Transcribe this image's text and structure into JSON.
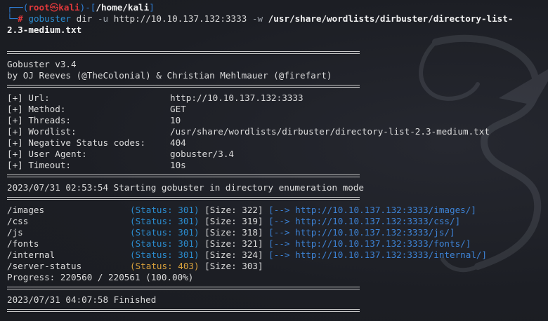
{
  "prompt": {
    "corner_top": "┌──(",
    "user": "root",
    "at_symbol": "㉿",
    "host": "kali",
    "mid": ")-[",
    "path": "/home/kali",
    "end": "]",
    "corner_bottom": "└─",
    "hash": "#",
    "cmd_bin": "gobuster",
    "cmd_sub": "dir",
    "flag_u": "-u",
    "url_arg": "http://10.10.137.132:3333",
    "flag_w": "-w",
    "wordlist_arg_1": "/usr/share/wordlists/dirbuster/directory-list-",
    "wordlist_arg_2": "2.3-medium.txt"
  },
  "banner": {
    "title": "Gobuster v3.4",
    "authors": "by OJ Reeves (@TheColonial) & Christian Mehlmauer (@firefart)"
  },
  "config": [
    {
      "key": "[+] Url:",
      "value": "http://10.10.137.132:3333"
    },
    {
      "key": "[+] Method:",
      "value": "GET"
    },
    {
      "key": "[+] Threads:",
      "value": "10"
    },
    {
      "key": "[+] Wordlist:",
      "value": "/usr/share/wordlists/dirbuster/directory-list-2.3-medium.txt"
    },
    {
      "key": "[+] Negative Status codes:",
      "value": "404"
    },
    {
      "key": "[+] User Agent:",
      "value": "gobuster/3.4"
    },
    {
      "key": "[+] Timeout:",
      "value": "10s"
    }
  ],
  "start_message": "2023/07/31 02:53:54 Starting gobuster in directory enumeration mode",
  "results": [
    {
      "path": "/images",
      "status": "(Status: 301)",
      "size": "[Size: 322]",
      "arrow": "[-->",
      "redirect": "http://10.10.137.132:3333/images/]"
    },
    {
      "path": "/css",
      "status": "(Status: 301)",
      "size": "[Size: 319]",
      "arrow": "[-->",
      "redirect": "http://10.10.137.132:3333/css/]"
    },
    {
      "path": "/js",
      "status": "(Status: 301)",
      "size": "[Size: 318]",
      "arrow": "[-->",
      "redirect": "http://10.10.137.132:3333/js/]"
    },
    {
      "path": "/fonts",
      "status": "(Status: 301)",
      "size": "[Size: 321]",
      "arrow": "[-->",
      "redirect": "http://10.10.137.132:3333/fonts/]"
    },
    {
      "path": "/internal",
      "status": "(Status: 301)",
      "size": "[Size: 324]",
      "arrow": "[-->",
      "redirect": "http://10.10.137.132:3333/internal/]"
    },
    {
      "path": "/server-status",
      "status": "(Status: 403)",
      "size": "[Size: 303]",
      "arrow": "",
      "redirect": ""
    }
  ],
  "progress": "Progress: 220560 / 220561 (100.00%)",
  "finish_message": "2023/07/31 04:07:58 Finished",
  "colors": {
    "background": "#1c1e24",
    "prompt_frame": "#2f7fd8",
    "prompt_user": "#e0383b",
    "status_301": "#2b8ccf",
    "status_403": "#d9a13c",
    "redirect_link": "#3d83d6"
  }
}
